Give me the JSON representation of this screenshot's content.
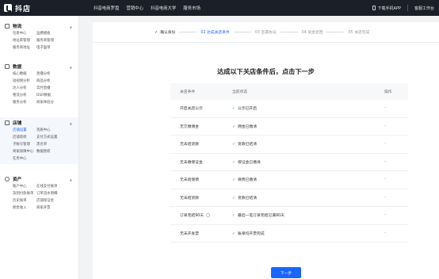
{
  "topbar": {
    "logo_text": "抖店",
    "nav": [
      "抖音电商罗盘",
      "营销中心",
      "抖音电商大学",
      "服务市场"
    ],
    "download_label": "下载手机APP",
    "workbench_label": "客服工作台"
  },
  "sidebar": {
    "sections": [
      {
        "title": "物流",
        "items": [
          "包裹中心",
          "运费模板",
          "地址库管理",
          "服务商管理",
          "服务商地址",
          "电子面单"
        ]
      },
      {
        "title": "数据",
        "items": [
          "核心数据",
          "直播分析",
          "短视频分析",
          "商品分析",
          "达人分析",
          "实时直播",
          "物流分析",
          "DSR数据",
          "服务分析",
          "商家体验分"
        ]
      },
      {
        "title": "店铺",
        "items": [
          "店铺设置",
          "资质中心",
          "店铺装修",
          "支付方式设置",
          "子账号管理",
          "黑名单",
          "商家保障中心",
          "数据授权",
          "任务中心"
        ]
      },
      {
        "title": "资产",
        "items": [
          "账户中心",
          "在线支付账单",
          "货到付款账单",
          "订单流水明细",
          "历史账单",
          "店铺保证金",
          "佣金收入",
          "商家开票"
        ]
      }
    ]
  },
  "steps": [
    {
      "label": "确认身份",
      "state": "done"
    },
    {
      "label": "02 达成关店条件",
      "state": "active"
    },
    {
      "label": "03 签署协议",
      "state": "todo"
    },
    {
      "label": "04 资金退回",
      "state": "todo"
    },
    {
      "label": "05 关店完成",
      "state": "todo"
    }
  ],
  "heading": "达成以下关店条件后，点击下一步",
  "table": {
    "headers": [
      "关店条件",
      "当前状态",
      "操作"
    ],
    "rows": [
      {
        "condition": "开启关店公示",
        "status": "公示已开启",
        "action": "–"
      },
      {
        "condition": "无欠缴佣金",
        "status": "佣金已缴清",
        "action": "–"
      },
      {
        "condition": "无未结货款",
        "status": "货款已结清",
        "action": "–"
      },
      {
        "condition": "无未缴保证金",
        "status": "保证金已缴清",
        "action": "–"
      },
      {
        "condition": "无未结保费",
        "status": "保费已缴清",
        "action": "–"
      },
      {
        "condition": "无未结货款",
        "status": "货款已结清",
        "action": "–"
      },
      {
        "condition": "订单完结90天",
        "status": "最后一笔订单完结已满90天",
        "action": "–"
      },
      {
        "condition": "无未开发票",
        "status": "账单均开票完成",
        "action": "–"
      }
    ]
  },
  "next_button": "下一步"
}
